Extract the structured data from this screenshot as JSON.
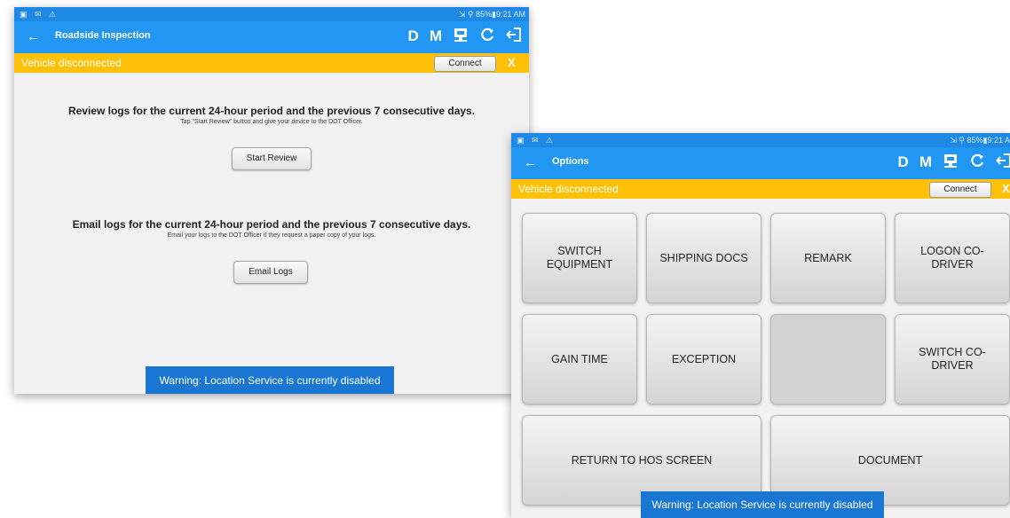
{
  "status": {
    "left_icons": "▣ ✉ ⚠",
    "right": "⇲ ⚲ 85%▮9:21 AM",
    "right_short": "⇲ ⚲ 85%▮9:21 A"
  },
  "screen1": {
    "title": "Roadside Inspection",
    "vehicle_msg": "Vehicle disconnected",
    "connect_label": "Connect",
    "close_label": "X",
    "review_heading": "Review logs for the current 24-hour period and the previous 7 consecutive days.",
    "review_sub": "Tap \"Start Review\" button and give your device to the DOT Officer.",
    "start_review_label": "Start Review",
    "email_heading": "Email logs for the current 24-hour period and the previous 7 consecutive days.",
    "email_sub": "Email your logs to the DOT Officer if they request a paper copy of your logs.",
    "email_logs_label": "Email Logs",
    "warning": "Warning: Location Service is currently disabled"
  },
  "screen2": {
    "title": "Options",
    "vehicle_msg": "Vehicle disconnected",
    "connect_label": "Connect",
    "close_label": "X",
    "tiles": [
      "SWITCH EQUIPMENT",
      "SHIPPING DOCS",
      "REMARK",
      "LOGON CO-DRIVER",
      "GAIN TIME",
      "EXCEPTION",
      "",
      "SWITCH CO-DRIVER",
      "RETURN TO HOS SCREEN",
      "DOCUMENT"
    ],
    "warning": "Warning: Location Service is currently disabled"
  },
  "toolbar": {
    "d_label": "D",
    "m_label": "M",
    "icons": [
      "inspection-icon",
      "refresh-icon",
      "logout-icon"
    ]
  },
  "colors": {
    "appbar": "#2196f3",
    "statusbar": "#1e88e5",
    "vehicle_bar": "#ffc107",
    "toast": "#1976d2"
  }
}
